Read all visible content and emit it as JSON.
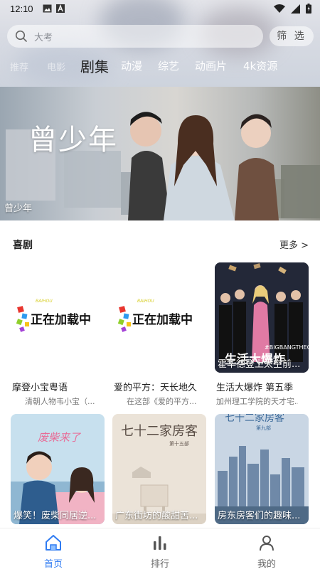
{
  "status_bar": {
    "time": "12:10",
    "left_icons": [
      "image-icon",
      "a-notification-icon"
    ],
    "right_icons": [
      "wifi-icon",
      "signal-icon",
      "battery-icon"
    ]
  },
  "search": {
    "placeholder": "大考"
  },
  "filter_label": "筛 选",
  "tabs": [
    {
      "label": "推荐",
      "state": "faded"
    },
    {
      "label": "电影",
      "state": "faded"
    },
    {
      "label": "剧集",
      "state": "active"
    },
    {
      "label": "动漫",
      "state": "normal"
    },
    {
      "label": "综艺",
      "state": "normal"
    },
    {
      "label": "动画片",
      "state": "normal"
    },
    {
      "label": "4k资源",
      "state": "normal"
    }
  ],
  "banner": {
    "title": "曾少年",
    "caption": "曾少年"
  },
  "section": {
    "title": "喜剧",
    "more_label": "更多 >"
  },
  "cards": [
    {
      "title": "摩登小宝粤语",
      "subtitle": "清朝人物韦小宝（...",
      "poster_text": "",
      "poster": "loading"
    },
    {
      "title": "爱的平方：天长地久",
      "subtitle": "在这部《爱的平方...",
      "poster_text": "",
      "poster": "loading"
    },
    {
      "title": "生活大爆炸 第五季",
      "subtitle": "加州理工学院的天才宅...",
      "poster_text": "霍华德登上太空前...",
      "poster": "big-bang"
    },
    {
      "title": "",
      "subtitle": "",
      "poster_text": "爆笑！废柴同居逆...",
      "poster": "couple"
    },
    {
      "title": "",
      "subtitle": "",
      "poster_text": "广东街坊的酸甜苦...",
      "poster": "room"
    },
    {
      "title": "",
      "subtitle": "",
      "poster_text": "房东房客们的趣味...",
      "poster": "city"
    }
  ],
  "loading_text": "正在加载中",
  "loading_brand": "BAIHOU",
  "poster_titles": {
    "big_bang": "生活大爆炸",
    "big_bang_en": "#BIGBANGTHEORY",
    "couple": "废柴来了",
    "room": "七十二家房客",
    "room_sub": "第十五部",
    "city": "七十二家房客",
    "city_sub": "第九部"
  },
  "bottom_nav": [
    {
      "label": "首页",
      "icon": "home-icon",
      "active": true
    },
    {
      "label": "排行",
      "icon": "bar-chart-icon",
      "active": false
    },
    {
      "label": "我的",
      "icon": "person-icon",
      "active": false
    }
  ],
  "colors": {
    "accent": "#2f7bf2"
  }
}
